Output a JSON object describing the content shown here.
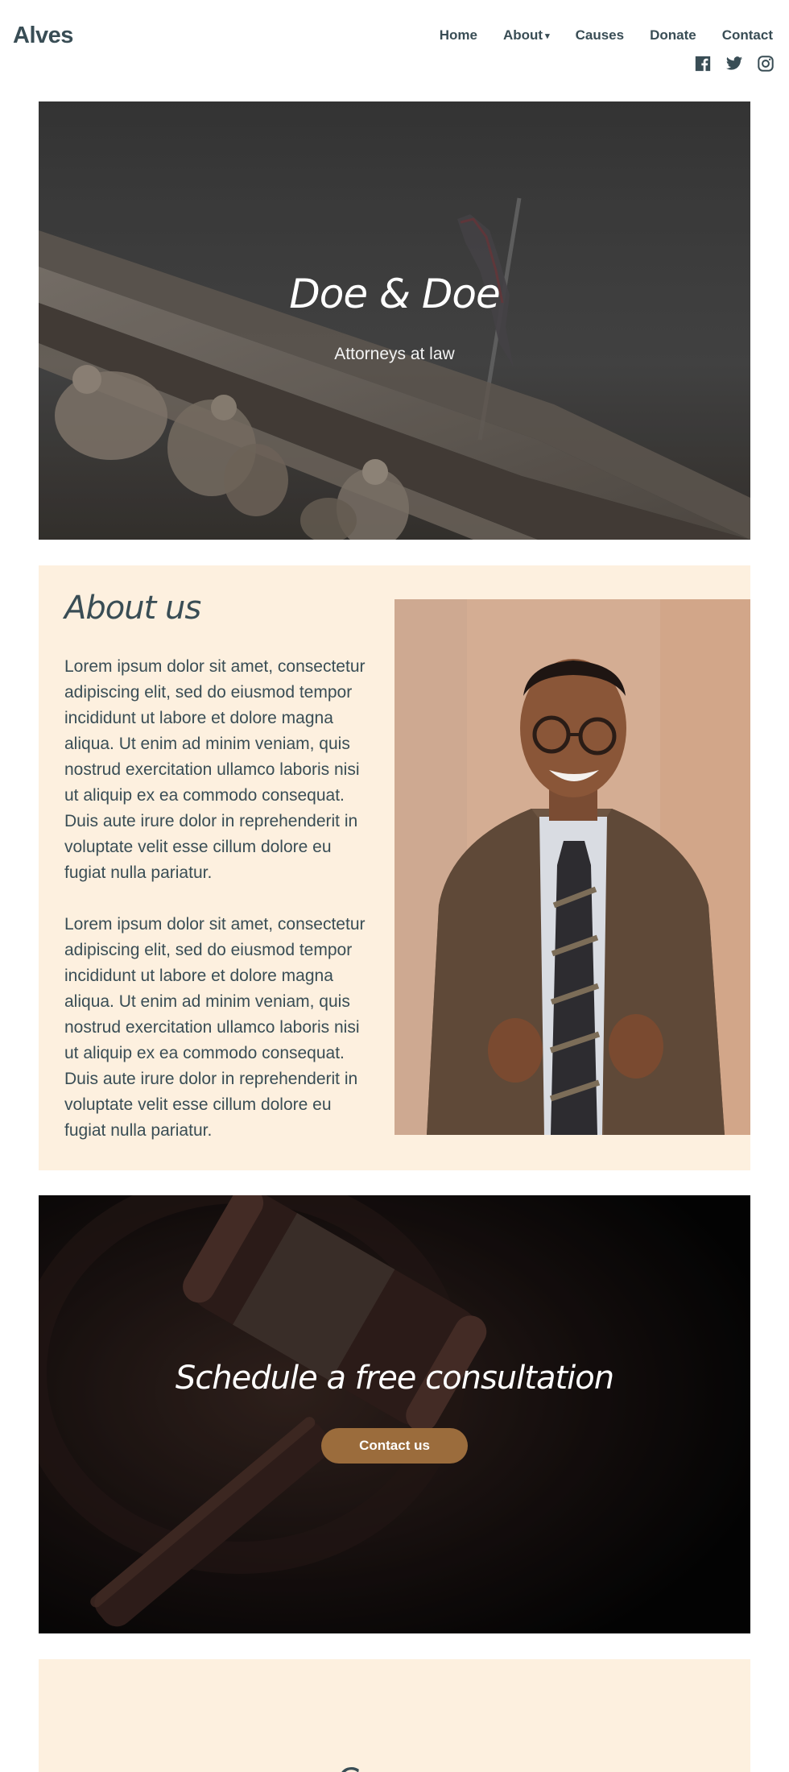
{
  "site": {
    "title": "Alves"
  },
  "nav": {
    "items": [
      {
        "label": "Home"
      },
      {
        "label": "About",
        "caret": "▾"
      },
      {
        "label": "Causes"
      },
      {
        "label": "Donate"
      },
      {
        "label": "Contact"
      }
    ]
  },
  "social": {
    "icons": [
      "facebook-icon",
      "twitter-icon",
      "instagram-icon"
    ]
  },
  "hero": {
    "title": "Doe & Doe",
    "subtitle": "Attorneys at law"
  },
  "about": {
    "heading": "About us",
    "paragraphs": [
      "Lorem ipsum dolor sit amet, consectetur adipiscing elit, sed do eiusmod tempor incididunt ut labore et dolore magna aliqua. Ut enim ad minim veniam, quis nostrud exercitation ullamco laboris nisi ut aliquip ex ea commodo consequat. Duis aute irure dolor in reprehenderit in voluptate velit esse cillum dolore eu fugiat nulla pariatur.",
      "Lorem ipsum dolor sit amet, consectetur adipiscing elit, sed do eiusmod tempor incididunt ut labore et dolore magna aliqua. Ut enim ad minim veniam, quis nostrud exercitation ullamco laboris nisi ut aliquip ex ea commodo consequat. Duis aute irure dolor in reprehenderit in voluptate velit esse cillum dolore eu fugiat nulla pariatur."
    ]
  },
  "consultation": {
    "title": "Schedule a free consultation",
    "button_label": "Contact us"
  },
  "causes": {
    "heading": "Causes"
  },
  "colors": {
    "text": "#394d55",
    "cream": "#fdf0df",
    "button": "#9b6c3c"
  }
}
